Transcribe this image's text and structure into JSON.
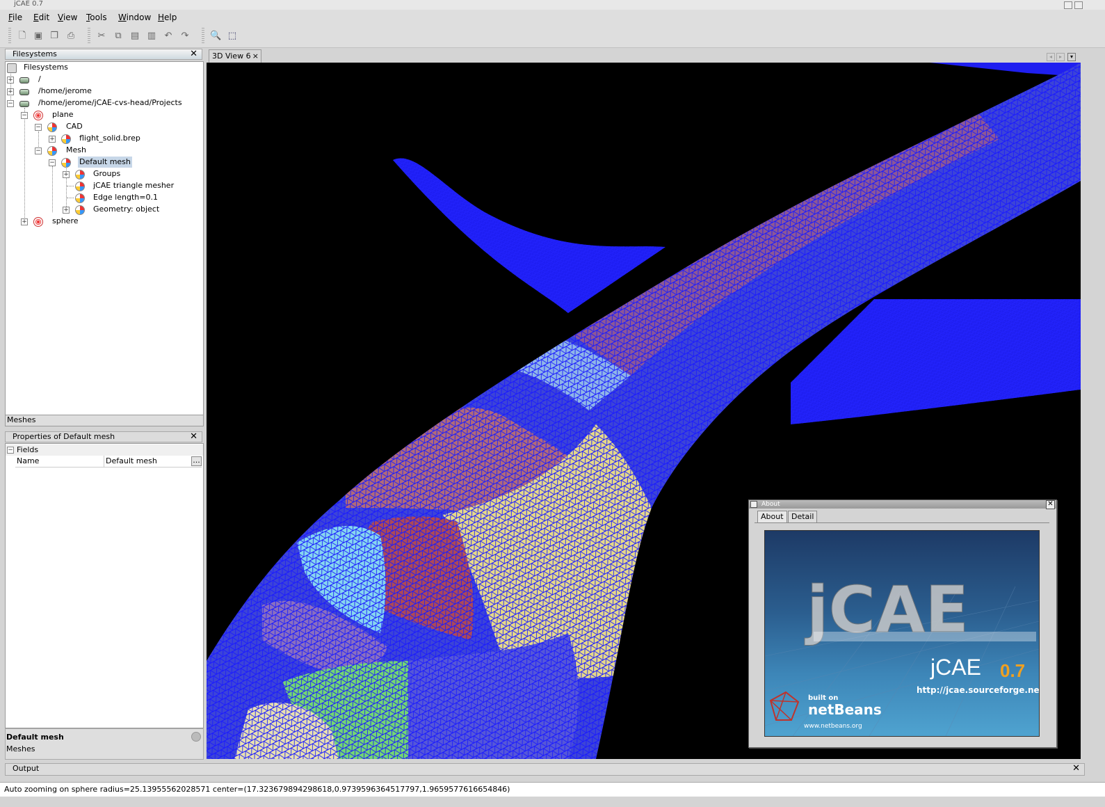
{
  "window": {
    "title": "jCAE 0.7"
  },
  "menu": {
    "items": [
      "File",
      "Edit",
      "View",
      "Tools",
      "Window",
      "Help"
    ]
  },
  "toolbar": {
    "icons": [
      "new-file-icon",
      "save-icon",
      "save-all-icon",
      "print-icon",
      "cut-icon",
      "copy-icon",
      "paste-icon",
      "delete-icon",
      "undo-icon",
      "redo-icon",
      "zoom-icon",
      "select-tool-icon"
    ]
  },
  "filesystems": {
    "title": "Filesystems",
    "tab_label": "Meshes",
    "tree": {
      "root": "Filesystems",
      "fs_root": "/",
      "home": "/home/jerome",
      "projects": "/home/jerome/jCAE-cvs-head/Projects",
      "plane": "plane",
      "cad": "CAD",
      "brep": "flight_solid.brep",
      "mesh": "Mesh",
      "default_mesh": "Default mesh",
      "groups": "Groups",
      "mesher": "jCAE triangle mesher",
      "edge": "Edge length=0.1",
      "geometry": "Geometry: object",
      "sphere": "sphere"
    }
  },
  "properties": {
    "title": "Properties of Default mesh",
    "section": "Fields",
    "rows": [
      {
        "name": "Name",
        "value": "Default mesh",
        "button": "..."
      }
    ],
    "desc_title": "Default mesh",
    "desc_text": "Meshes"
  },
  "view": {
    "tab_label": "3D View 6",
    "tab_close": "×"
  },
  "about": {
    "title": "About",
    "tabs": [
      "About",
      "Detail"
    ],
    "splash": {
      "product": "jCAE",
      "version": "0.7",
      "url": "http://jcae.sourceforge.net",
      "built_on": "built on",
      "netbeans": "netBeans",
      "netbeans_url": "www.netbeans.org"
    }
  },
  "output": {
    "title": "Output",
    "status": "Auto zooming on sphere radius=25.13955562028571 center=(17.323679894298618,0.9739596364517797,1.9659577616654846)"
  },
  "colors": {
    "mesh_edge": "#1a1aff",
    "viewport_bg": "#000000",
    "selection": "#c7d7e8"
  }
}
